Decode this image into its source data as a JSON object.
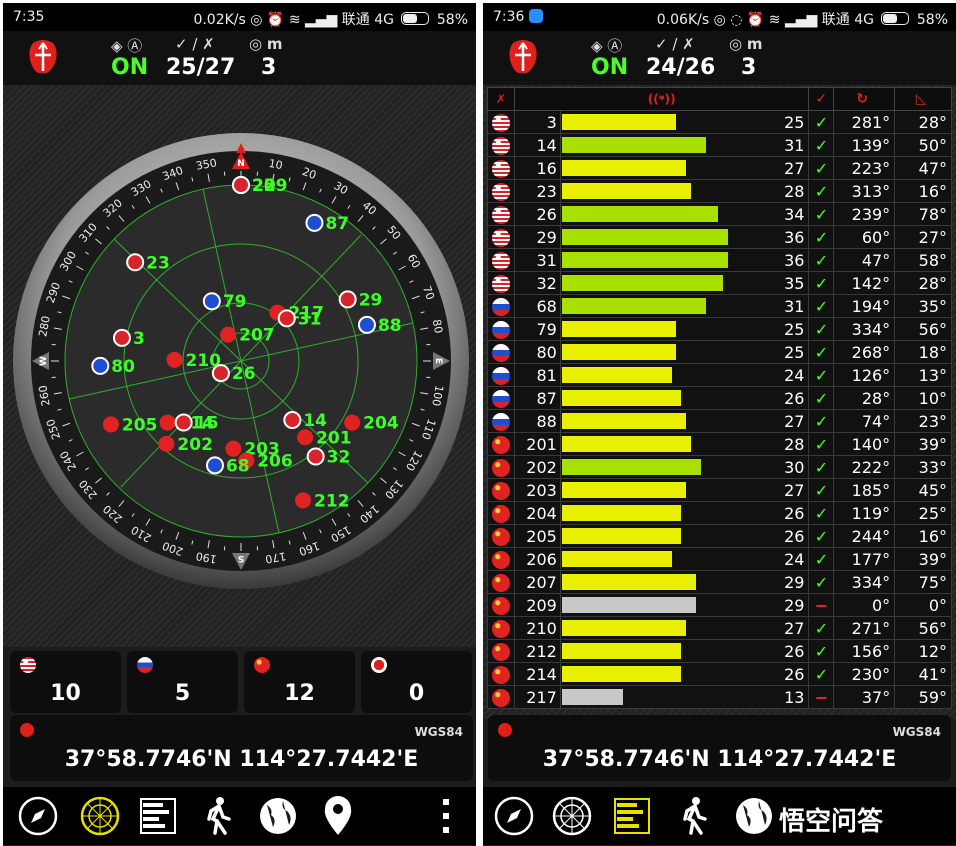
{
  "left": {
    "status": {
      "time": "7:35",
      "net_speed": "0.02K/s",
      "carrier": "联通 4G",
      "battery": "58%"
    },
    "header": {
      "fix_status": "ON",
      "sats": "25/27",
      "accuracy": "3",
      "unit": "m"
    },
    "compass_ticks": [
      "10",
      "20",
      "30",
      "40",
      "50",
      "60",
      "70",
      "80",
      "100",
      "110",
      "120",
      "130",
      "140",
      "150",
      "160",
      "170",
      "190",
      "200",
      "210",
      "220",
      "230",
      "240",
      "250",
      "260",
      "280",
      "290",
      "300",
      "310",
      "320",
      "330",
      "340",
      "350"
    ],
    "cardinals": [
      "N",
      "E",
      "S",
      "W"
    ],
    "radar_sats": [
      {
        "prn": "209",
        "flag": "cn"
      },
      {
        "prn": "87",
        "flag": "ru"
      },
      {
        "prn": "25",
        "flag": "us"
      },
      {
        "prn": "23",
        "flag": "us"
      },
      {
        "prn": "29",
        "flag": "us"
      },
      {
        "prn": "88",
        "flag": "ru"
      },
      {
        "prn": "79",
        "flag": "ru"
      },
      {
        "prn": "217",
        "flag": "cn"
      },
      {
        "prn": "31",
        "flag": "us"
      },
      {
        "prn": "207",
        "flag": "cn"
      },
      {
        "prn": "3",
        "flag": "us"
      },
      {
        "prn": "210",
        "flag": "cn"
      },
      {
        "prn": "80",
        "flag": "ru"
      },
      {
        "prn": "26",
        "flag": "us"
      },
      {
        "prn": "204",
        "flag": "cn"
      },
      {
        "prn": "14",
        "flag": "us"
      },
      {
        "prn": "201",
        "flag": "cn"
      },
      {
        "prn": "32",
        "flag": "us"
      },
      {
        "prn": "22",
        "flag": "us"
      },
      {
        "prn": "214",
        "flag": "cn"
      },
      {
        "prn": "16",
        "flag": "us"
      },
      {
        "prn": "205",
        "flag": "cn"
      },
      {
        "prn": "202",
        "flag": "cn"
      },
      {
        "prn": "203",
        "flag": "cn"
      },
      {
        "prn": "206",
        "flag": "cn"
      },
      {
        "prn": "68",
        "flag": "ru"
      },
      {
        "prn": "212",
        "flag": "cn"
      }
    ],
    "counts": [
      {
        "flag": "us",
        "count": "10"
      },
      {
        "flag": "ru",
        "count": "5"
      },
      {
        "flag": "cn",
        "count": "12"
      },
      {
        "flag": "red",
        "count": "0"
      }
    ],
    "datum": "WGS84",
    "coords": "37°58.7746'N   114°27.7442'E"
  },
  "right": {
    "status": {
      "time": "7:36",
      "net_speed": "0.06K/s",
      "carrier": "联通 4G",
      "battery": "58%"
    },
    "header": {
      "fix_status": "ON",
      "sats": "24/26",
      "accuracy": "3",
      "unit": "m"
    },
    "columns": {
      "signal_icon": "((ᵠ))",
      "used_icon": "✓",
      "azimuth_icon": "↻",
      "elevation_icon": "◺"
    },
    "rows": [
      {
        "flag": "us",
        "prn": "3",
        "snr": "25",
        "used": "✓",
        "az": "281°",
        "el": "28°",
        "level": 0.47,
        "color": "#e8f000"
      },
      {
        "flag": "us",
        "prn": "14",
        "snr": "31",
        "used": "✓",
        "az": "139°",
        "el": "50°",
        "level": 0.59,
        "color": "#a8e000"
      },
      {
        "flag": "us",
        "prn": "16",
        "snr": "27",
        "used": "✓",
        "az": "223°",
        "el": "47°",
        "level": 0.51,
        "color": "#e8f000"
      },
      {
        "flag": "us",
        "prn": "23",
        "snr": "28",
        "used": "✓",
        "az": "313°",
        "el": "16°",
        "level": 0.53,
        "color": "#e8f000"
      },
      {
        "flag": "us",
        "prn": "26",
        "snr": "34",
        "used": "✓",
        "az": "239°",
        "el": "78°",
        "level": 0.64,
        "color": "#a8e000"
      },
      {
        "flag": "us",
        "prn": "29",
        "snr": "36",
        "used": "✓",
        "az": "60°",
        "el": "27°",
        "level": 0.68,
        "color": "#a8e000"
      },
      {
        "flag": "us",
        "prn": "31",
        "snr": "36",
        "used": "✓",
        "az": "47°",
        "el": "58°",
        "level": 0.68,
        "color": "#a8e000"
      },
      {
        "flag": "us",
        "prn": "32",
        "snr": "35",
        "used": "✓",
        "az": "142°",
        "el": "28°",
        "level": 0.66,
        "color": "#a8e000"
      },
      {
        "flag": "ru",
        "prn": "68",
        "snr": "31",
        "used": "✓",
        "az": "194°",
        "el": "35°",
        "level": 0.59,
        "color": "#a8e000"
      },
      {
        "flag": "ru",
        "prn": "79",
        "snr": "25",
        "used": "✓",
        "az": "334°",
        "el": "56°",
        "level": 0.47,
        "color": "#e8f000"
      },
      {
        "flag": "ru",
        "prn": "80",
        "snr": "25",
        "used": "✓",
        "az": "268°",
        "el": "18°",
        "level": 0.47,
        "color": "#e8f000"
      },
      {
        "flag": "ru",
        "prn": "81",
        "snr": "24",
        "used": "✓",
        "az": "126°",
        "el": "13°",
        "level": 0.45,
        "color": "#e8f000"
      },
      {
        "flag": "ru",
        "prn": "87",
        "snr": "26",
        "used": "✓",
        "az": "28°",
        "el": "10°",
        "level": 0.49,
        "color": "#e8f000"
      },
      {
        "flag": "ru",
        "prn": "88",
        "snr": "27",
        "used": "✓",
        "az": "74°",
        "el": "23°",
        "level": 0.51,
        "color": "#e8f000"
      },
      {
        "flag": "cn",
        "prn": "201",
        "snr": "28",
        "used": "✓",
        "az": "140°",
        "el": "39°",
        "level": 0.53,
        "color": "#e8f000"
      },
      {
        "flag": "cn",
        "prn": "202",
        "snr": "30",
        "used": "✓",
        "az": "222°",
        "el": "33°",
        "level": 0.57,
        "color": "#a8e000"
      },
      {
        "flag": "cn",
        "prn": "203",
        "snr": "27",
        "used": "✓",
        "az": "185°",
        "el": "45°",
        "level": 0.51,
        "color": "#e8f000"
      },
      {
        "flag": "cn",
        "prn": "204",
        "snr": "26",
        "used": "✓",
        "az": "119°",
        "el": "25°",
        "level": 0.49,
        "color": "#e8f000"
      },
      {
        "flag": "cn",
        "prn": "205",
        "snr": "26",
        "used": "✓",
        "az": "244°",
        "el": "16°",
        "level": 0.49,
        "color": "#e8f000"
      },
      {
        "flag": "cn",
        "prn": "206",
        "snr": "24",
        "used": "✓",
        "az": "177°",
        "el": "39°",
        "level": 0.45,
        "color": "#e8f000"
      },
      {
        "flag": "cn",
        "prn": "207",
        "snr": "29",
        "used": "✓",
        "az": "334°",
        "el": "75°",
        "level": 0.55,
        "color": "#e8f000"
      },
      {
        "flag": "cn",
        "prn": "209",
        "snr": "29",
        "used": "−",
        "az": "0°",
        "el": "0°",
        "level": 0.55,
        "color": "#c8c8c8"
      },
      {
        "flag": "cn",
        "prn": "210",
        "snr": "27",
        "used": "✓",
        "az": "271°",
        "el": "56°",
        "level": 0.51,
        "color": "#e8f000"
      },
      {
        "flag": "cn",
        "prn": "212",
        "snr": "26",
        "used": "✓",
        "az": "156°",
        "el": "12°",
        "level": 0.49,
        "color": "#e8f000"
      },
      {
        "flag": "cn",
        "prn": "214",
        "snr": "26",
        "used": "✓",
        "az": "230°",
        "el": "41°",
        "level": 0.49,
        "color": "#e8f000"
      },
      {
        "flag": "cn",
        "prn": "217",
        "snr": "13",
        "used": "−",
        "az": "37°",
        "el": "59°",
        "level": 0.25,
        "color": "#c8c8c8"
      }
    ],
    "datum": "WGS84",
    "coords": "37°58.7746'N   114°27.7442'E",
    "watermark": "悟空问答"
  },
  "nav_icons": [
    "compass-icon",
    "radar-icon",
    "bar-chart-icon",
    "walker-icon",
    "globe-icon",
    "location-pin-icon",
    "more-icon"
  ],
  "colors": {
    "accent_green": "#4cff2a",
    "radar_green": "#2fae2f",
    "logo_red": "#e0201c"
  }
}
